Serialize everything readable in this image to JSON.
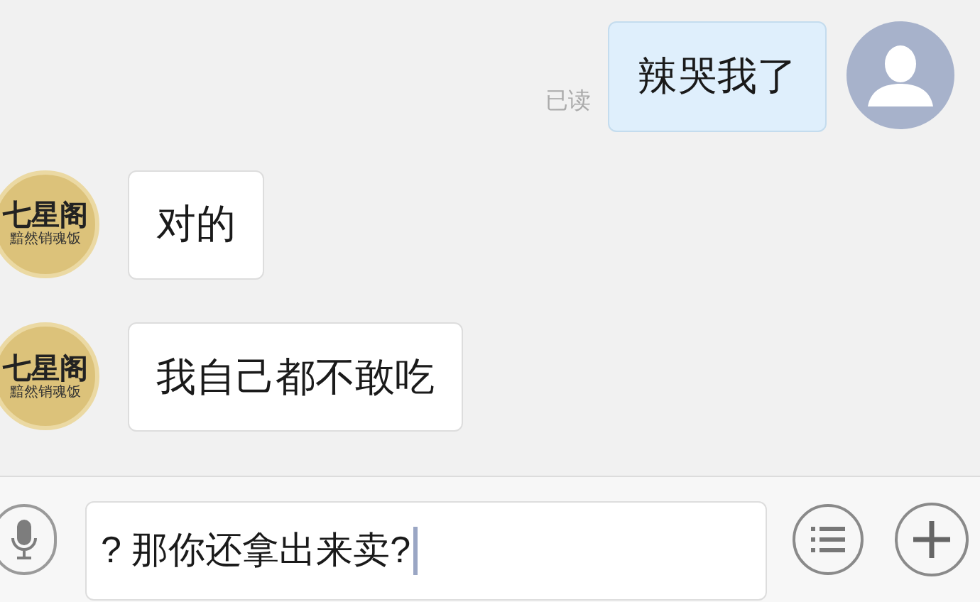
{
  "messages": [
    {
      "kind": "out",
      "text": "辣哭我了",
      "status": "已读"
    },
    {
      "kind": "in",
      "text": "对的",
      "avatar": {
        "name": "七星阁",
        "slogan": "黯然销魂饭"
      }
    },
    {
      "kind": "in",
      "text": "我自己都不敢吃",
      "avatar": {
        "name": "七星阁",
        "slogan": "黯然销魂饭"
      }
    }
  ],
  "input": {
    "value": "? 那你还拿出来卖?"
  }
}
